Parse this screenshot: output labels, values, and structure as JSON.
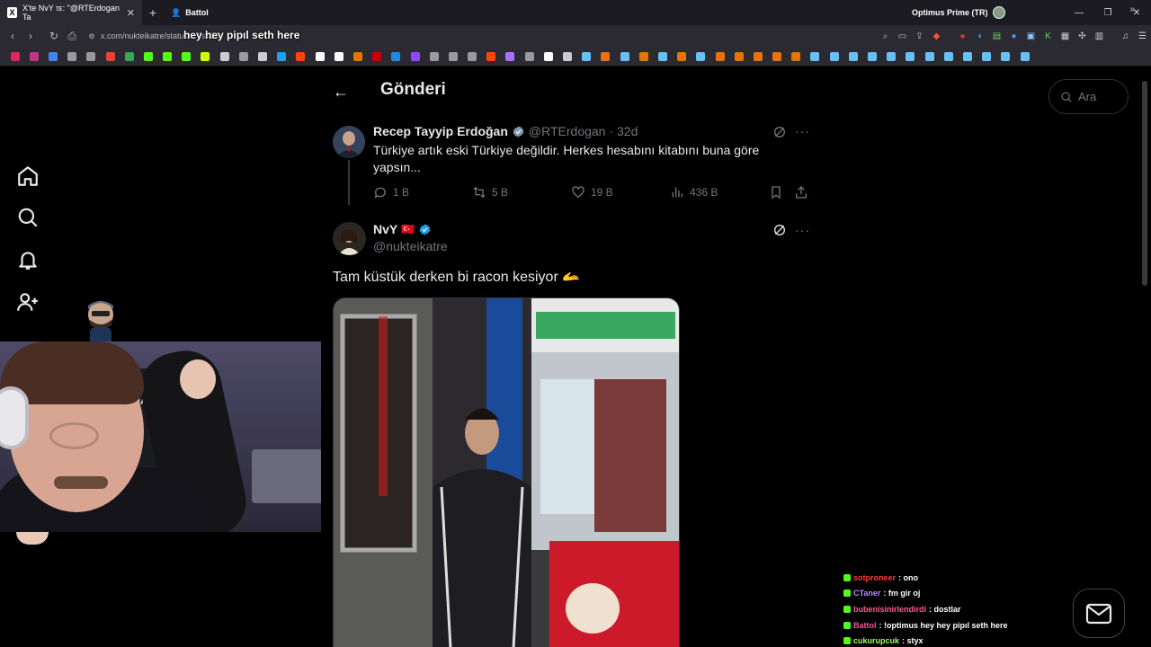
{
  "browser": {
    "tab_title": "X'te NvY τε: \"@RTErdogan Ta",
    "tab2_title": "Battol",
    "profile_name": "Optimus Prime (TR)",
    "url": "x.com/nukteikatre/status/...?s=20",
    "overlay_text": "hey hey pipıl seth here",
    "accent": "#ffffff"
  },
  "bookmark_colors": [
    "#e0245e",
    "#c13584",
    "#4285f4",
    "#999",
    "#999",
    "#ea4335",
    "#34a853",
    "#53fc18",
    "#53fc18",
    "#53fc18",
    "#ccff00",
    "#ccc",
    "#999",
    "#ccc",
    "#1da1f2",
    "#ff4500",
    "#fff",
    "#fff",
    "#e8710a",
    "#cc0000",
    "#1e88e5",
    "#9146ff",
    "#999",
    "#999",
    "#999",
    "#ff4500",
    "#a970ff",
    "#999",
    "#fff",
    "#ccc",
    "#66c0f4",
    "#e8710a",
    "#66c0f4",
    "#e8710a",
    "#66c0f4",
    "#e8710a",
    "#66c0f4",
    "#e8710a",
    "#e8710a",
    "#e8710a",
    "#e8710a",
    "#e8710a",
    "#66c0f4",
    "#66c0f4",
    "#66c0f4",
    "#66c0f4",
    "#66c0f4",
    "#66c0f4",
    "#66c0f4",
    "#66c0f4",
    "#66c0f4",
    "#66c0f4",
    "#66c0f4",
    "#66c0f4"
  ],
  "page": {
    "title": "Gönderi",
    "search_placeholder": "Ara"
  },
  "quoted_tweet": {
    "name": "Recep Tayyip Erdoğan",
    "handle": "@RTErdogan",
    "time": "· 32d",
    "text": "Türkiye artık eski Türkiye değildir. Herkes hesabını kitabını buna göre yapsın...",
    "replies": "1 B",
    "retweets": "5 B",
    "likes": "19 B",
    "views": "436 B"
  },
  "tweet": {
    "name": "NvY",
    "flag": "🇹🇷",
    "handle": "@nukteikatre",
    "text": "Tam küstük derken bi racon kesiyor 🫴"
  },
  "chat": [
    {
      "user": "sotproneer",
      "msg": ": ono",
      "color": "#ff3b3b"
    },
    {
      "user": "CTaner",
      "msg": ": fm gir oj",
      "color": "#b58cff"
    },
    {
      "user": "bubenisinirlendirdi",
      "msg": ": dostlar",
      "color": "#ff5c8a"
    },
    {
      "user": "Battol",
      "msg": ": !optimus hey hey pipıl seth here",
      "color": "#ff4fa0"
    },
    {
      "user": "cukurupcuk",
      "msg": ": styx",
      "color": "#9cff57"
    }
  ],
  "colors": {
    "background": "#000000",
    "text": "#e7e9ea",
    "muted": "#71767b",
    "verified": "#1d9bf0"
  }
}
